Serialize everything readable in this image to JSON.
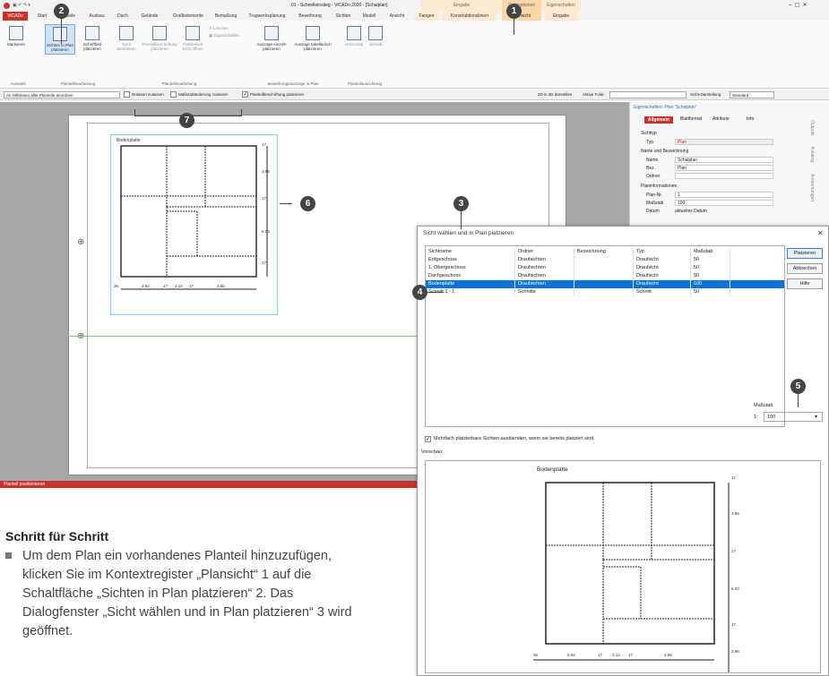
{
  "app": {
    "title": "01 - Schnelleinstieg - ViCADo 2020 - [Schalplan]",
    "ctx_group1": "Eingabe",
    "ctx_group2": "Sichtoptionen",
    "ctx_group3": "Eigenschaften",
    "tabs": [
      "ViCADo",
      "Start",
      "Bauteile",
      "Ausbau",
      "Dach",
      "Gelände",
      "Grafikelemente",
      "Bemaßung",
      "Tragwerksplanung",
      "Bewehrung",
      "Sichten",
      "Modell",
      "Ansicht",
      "Fangen",
      "Konstruktionslinien",
      "Plansicht",
      "Eingabe"
    ],
    "ribbon_buttons": [
      "Markieren",
      "Sichten in Plan platzieren",
      "Schriftfeld platzieren",
      "Sicht bearbeiten",
      "Planteilbeschriftung platzieren",
      "Plotbereich Sicht öffnen",
      "Löschen",
      "Eigenschaften",
      "Auszüge einzeln platzieren",
      "Auszüge tabellarisch platzieren",
      "Horizontal",
      "Vertikal"
    ],
    "ribbon_groups": [
      "Auswahl",
      "Planteilbearbeitung",
      "Planteilbearbeitung",
      "Bewehrungsauszüge in Plan",
      "Planteilausrichtung"
    ],
    "options": {
      "dropdown": "An Hilfslinien aller Planteile anordnen",
      "cb1": "Rotation zulassen",
      "cb2": "Maßstabänderung zulassen",
      "cb3": "Planteilbeschriftung platzieren",
      "show3d": "2D in 3D darstellen",
      "active_folie": "Aktive Folie:",
      "sicht_label": "Sicht-Darstellung",
      "sicht_value": "Standard"
    },
    "status": "Planteil positionieren",
    "sheet_label": "Bodenplatte"
  },
  "props": {
    "title": "Eigenschaften: Plan 'Schalplan'",
    "tabs": [
      "Allgemein",
      "Blattformat",
      "Attribute",
      "Info"
    ],
    "sections": [
      "Sichttyp",
      "Name und Bezeichnung",
      "Planinformationen"
    ],
    "rows": [
      {
        "label": "Typ",
        "value": "Plan"
      },
      {
        "label": "Name",
        "value": "Schalplan"
      },
      {
        "label": "Bez.",
        "value": "Plan"
      },
      {
        "label": "Ordner",
        "value": ""
      },
      {
        "label": "Plan-Nr.",
        "value": "1"
      },
      {
        "label": "Maßstab",
        "value": "100"
      },
      {
        "label": "Datum",
        "value": "aktuelles Datum"
      }
    ],
    "side_tabs": [
      "Outputs",
      "Katalog",
      "Anmerkungen"
    ]
  },
  "dialog": {
    "title": "Sicht wählen und in Plan platzieren",
    "columns": [
      "Sichtname",
      "Ordner",
      "Bezeichnung",
      "Typ",
      "Maßstab"
    ],
    "rows": [
      {
        "name": "Erdgeschoss",
        "ordner": "Draufsichten",
        "bez": "",
        "typ": "Draufsicht",
        "mst": "50"
      },
      {
        "name": "1. Obergeschoss",
        "ordner": "Draufsichten",
        "bez": "",
        "typ": "Draufsicht",
        "mst": "50"
      },
      {
        "name": "Dachgeschoss",
        "ordner": "Draufsichten",
        "bez": "",
        "typ": "Draufsicht",
        "mst": "50"
      },
      {
        "name": "Bodenplatte",
        "ordner": "Draufsichten",
        "bez": "",
        "typ": "Draufsicht",
        "mst": "100"
      },
      {
        "name": "Schnitt 1 - 1",
        "ordner": "Schnitte",
        "bez": "",
        "typ": "Schnitt",
        "mst": "50"
      }
    ],
    "selected_row": 3,
    "buttons": [
      "Platzieren",
      "Abbrechen",
      "Hilfe"
    ],
    "scale_label": "Maßstab",
    "scale_prefix": "1:",
    "scale_value": "100",
    "checkbox": "Mehrfach platzierbare Sichten ausblenden, wenn sie bereits platziert sind",
    "preview_label": "Vorschau:",
    "preview_title": "Bodenplatte"
  },
  "dims": {
    "bottom": [
      "3.92",
      "17",
      "2.12",
      "17",
      "3.88",
      "36"
    ],
    "right": [
      "3.96",
      "17",
      "6.03",
      "17",
      "3.96"
    ]
  },
  "callouts": [
    "1",
    "2",
    "3",
    "4",
    "5",
    "6",
    "7"
  ],
  "steps": {
    "title": "Schritt für Schritt",
    "text": "Um dem Plan ein vorhandenes Planteil hinzuzufügen, klicken Sie im Kontextregister „Plansicht“ 1 auf die Schaltfläche „Sichten in Plan platzieren“ 2. Das Dialogfenster „Sicht wählen und in Plan platzieren“ 3 wird geöffnet."
  }
}
